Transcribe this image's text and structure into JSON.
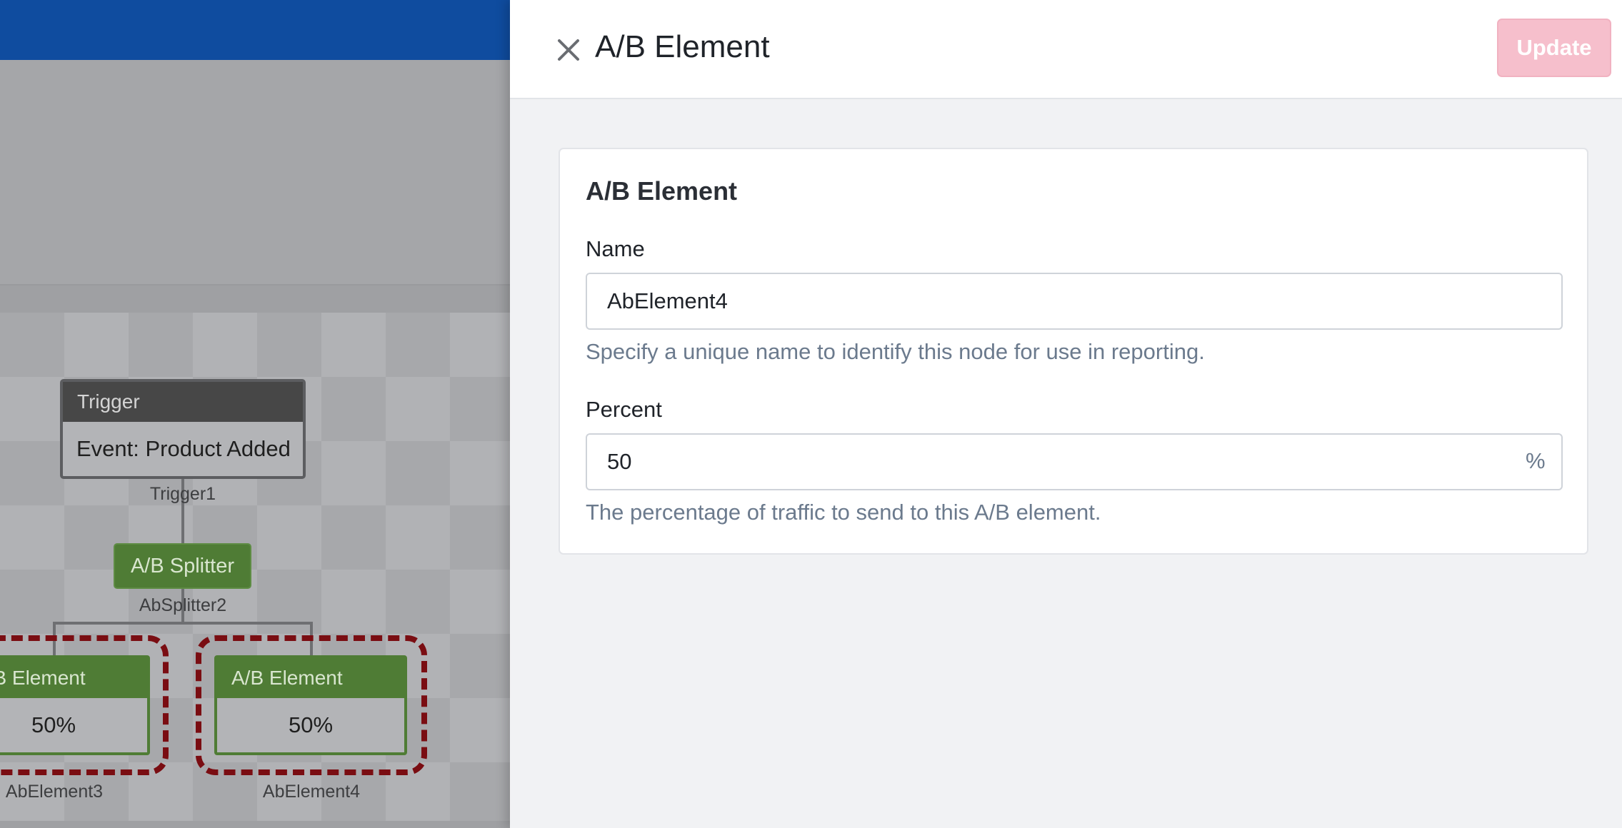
{
  "canvas": {
    "trigger_node": {
      "header": "Trigger",
      "body": "Event: Product Added",
      "caption": "Trigger1"
    },
    "splitter_node": {
      "label": "A/B Splitter",
      "caption": "AbSplitter2"
    },
    "ab_nodes": [
      {
        "header": "A/B Element",
        "percent": "50%",
        "caption": "AbElement3"
      },
      {
        "header": "A/B Element",
        "percent": "50%",
        "caption": "AbElement4"
      }
    ],
    "colors": {
      "topbar": "#0f4c9f",
      "node_green": "#4f7c35",
      "selection_outline": "#7a0d12"
    }
  },
  "drawer": {
    "close_icon": "close-icon",
    "title": "A/B Element",
    "update_label": "Update",
    "card": {
      "title": "A/B Element",
      "name_label": "Name",
      "name_value": "AbElement4",
      "name_help": "Specify a unique name to identify this node for use in reporting.",
      "percent_label": "Percent",
      "percent_value": "50",
      "percent_suffix": "%",
      "percent_help": "The percentage of traffic to send to this A/B element."
    },
    "colors": {
      "update_button_disabled": "#f6bfcc"
    }
  }
}
